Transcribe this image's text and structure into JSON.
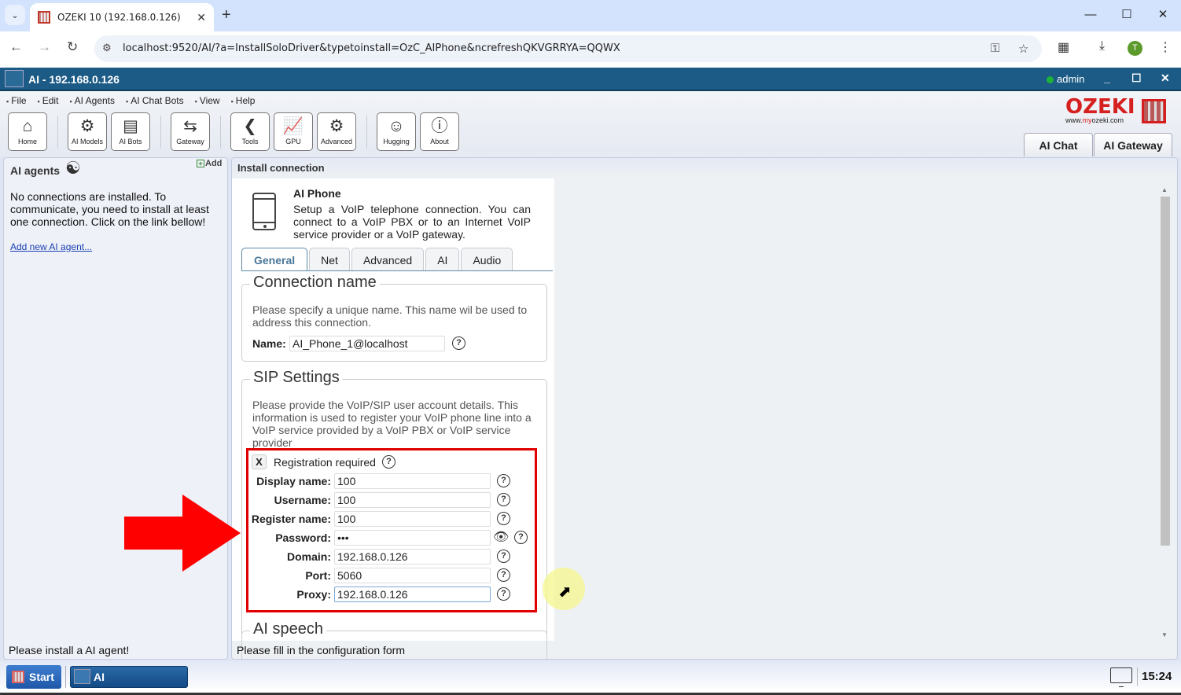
{
  "browser": {
    "tab_title": "OZEKI 10 (192.168.0.126)",
    "url": "localhost:9520/AI/?a=InstallSoloDriver&typetoinstall=OzC_AIPhone&ncrefreshQKVGRRYA=QQWX",
    "profile_initial": "T"
  },
  "app": {
    "title": "AI - 192.168.0.126",
    "user": "admin",
    "status_color": "#1db33a"
  },
  "menu": [
    "File",
    "Edit",
    "AI Agents",
    "AI Chat Bots",
    "View",
    "Help"
  ],
  "toolbar": [
    {
      "label": "Home",
      "icon": "home-icon"
    },
    {
      "label": "AI Models",
      "icon": "ai-models-icon"
    },
    {
      "label": "AI Bots",
      "icon": "ai-bots-icon"
    },
    {
      "label": "Gateway",
      "icon": "gateway-icon"
    },
    {
      "label": "Tools",
      "icon": "tools-icon"
    },
    {
      "label": "GPU",
      "icon": "gpu-icon"
    },
    {
      "label": "Advanced",
      "icon": "gear-icon"
    },
    {
      "label": "Hugging",
      "icon": "hugging-face-icon"
    },
    {
      "label": "About",
      "icon": "info-icon"
    }
  ],
  "brand": {
    "name": "OZEKI",
    "url_prefix": "www.",
    "url_highlight": "my",
    "url_suffix": "ozeki.com",
    "color": "#d62020"
  },
  "mode_tabs": [
    "AI Chat",
    "AI Gateway"
  ],
  "left_panel": {
    "title": "AI agents",
    "add_label": "Add",
    "message": "No connections are installed. To communicate, you need to install at least one connection. Click on the link bellow!",
    "link": "Add new AI agent...",
    "status": "Please install a AI agent!"
  },
  "right_panel": {
    "title": "Install connection",
    "status": "Please fill in the configuration form",
    "connection_type": "AI Phone",
    "connection_desc": "Setup a VoIP telephone connection. You can connect to a VoIP PBX or to an Internet VoIP service provider or a VoIP gateway.",
    "tabs": [
      "General",
      "Net",
      "Advanced",
      "AI",
      "Audio"
    ],
    "active_tab": "General",
    "connection_name": {
      "legend": "Connection name",
      "desc": "Please specify a unique name. This name wil be used to address this connection.",
      "label": "Name:",
      "value": "AI_Phone_1@localhost"
    },
    "sip": {
      "legend": "SIP Settings",
      "desc": "Please provide the VoIP/SIP user account details. This information is used to register your VoIP phone line into a VoIP service provided by a VoIP PBX or VoIP service provider",
      "registration_label": "Registration required",
      "registration_checked": "X",
      "fields": [
        {
          "label": "Display name:",
          "value": "100"
        },
        {
          "label": "Username:",
          "value": "100"
        },
        {
          "label": "Register name:",
          "value": "100"
        },
        {
          "label": "Password:",
          "value": "•••"
        },
        {
          "label": "Domain:",
          "value": "192.168.0.126"
        },
        {
          "label": "Port:",
          "value": "5060"
        },
        {
          "label": "Proxy:",
          "value": "192.168.0.126"
        }
      ]
    },
    "ai_speech_legend": "AI speech"
  },
  "taskbar": {
    "start_label": "Start",
    "app_label": "AI",
    "clock": "15:24"
  },
  "annotation_color": "#e00000"
}
